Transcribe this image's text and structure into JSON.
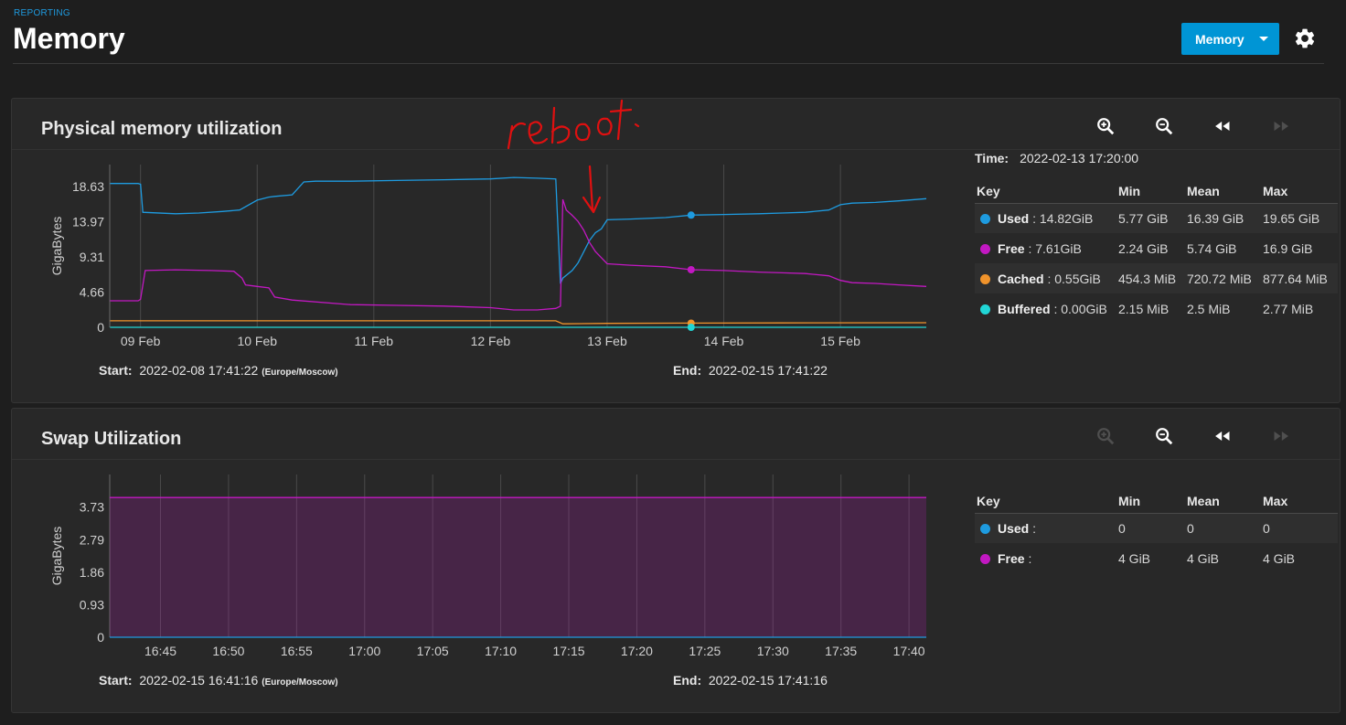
{
  "header": {
    "breadcrumb": "REPORTING",
    "title": "Memory",
    "dropdown_label": "Memory"
  },
  "icons": {
    "settings": "gear-icon",
    "zoom_in": "zoom-in-icon",
    "zoom_out": "zoom-out-icon",
    "back": "rewind-icon",
    "forward": "fast-forward-icon"
  },
  "colors": {
    "used": "#1e9be0",
    "free": "#c218c2",
    "cached": "#f0932b",
    "buffered": "#21d6d6",
    "accent": "#0095d5"
  },
  "physical": {
    "title": "Physical memory utilization",
    "time_label": "Time:",
    "time_value": "2022-02-13 17:20:00",
    "start_label": "Start:",
    "start_value": "2022-02-08 17:41:22",
    "timezone": "(Europe/Moscow)",
    "end_label": "End:",
    "end_value": "2022-02-15 17:41:22",
    "legend_headers": [
      "Key",
      "Min",
      "Mean",
      "Max"
    ],
    "legend_rows": [
      {
        "key": "Used",
        "value": " : 14.82GiB",
        "min": "5.77 GiB",
        "mean": "16.39 GiB",
        "max": "19.65 GiB"
      },
      {
        "key": "Free",
        "value": " : 7.61GiB",
        "min": "2.24 GiB",
        "mean": "5.74 GiB",
        "max": "16.9 GiB"
      },
      {
        "key": "Cached",
        "value": " : 0.55GiB",
        "min": "454.3 MiB",
        "mean": "720.72 MiB",
        "max": "877.64 MiB"
      },
      {
        "key": "Buffered",
        "value": " : 0.00GiB",
        "min": "2.15 MiB",
        "mean": "2.5 MiB",
        "max": "2.77 MiB"
      }
    ],
    "annotation": "reboot"
  },
  "swap": {
    "title": "Swap Utilization",
    "start_label": "Start:",
    "start_value": "2022-02-15 16:41:16",
    "timezone": "(Europe/Moscow)",
    "end_label": "End:",
    "end_value": "2022-02-15 17:41:16",
    "legend_headers": [
      "Key",
      "Min",
      "Mean",
      "Max"
    ],
    "legend_rows": [
      {
        "key": "Used",
        "value": " :",
        "min": "0",
        "mean": "0",
        "max": "0"
      },
      {
        "key": "Free",
        "value": " :",
        "min": "4 GiB",
        "mean": "4 GiB",
        "max": "4 GiB"
      }
    ]
  },
  "chart_data": [
    {
      "type": "line",
      "ylabel": "GigaBytes",
      "ylim": [
        0,
        21.5
      ],
      "yticks": [
        "0",
        "4.66",
        "9.31",
        "13.97",
        "18.63"
      ],
      "ytick_values": [
        0,
        4.66,
        9.31,
        13.97,
        18.63
      ],
      "xlim": [
        8.736,
        15.736
      ],
      "xticks": [
        "09 Feb",
        "10 Feb",
        "11 Feb",
        "12 Feb",
        "13 Feb",
        "14 Feb",
        "15 Feb"
      ],
      "xtick_values": [
        9,
        10,
        11,
        12,
        13,
        14,
        15
      ],
      "grid": true,
      "series": [
        {
          "name": "Used",
          "x": [
            8.74,
            8.98,
            9.0,
            9.02,
            9.3,
            9.5,
            9.7,
            9.85,
            10.0,
            10.1,
            10.15,
            10.3,
            10.4,
            10.5,
            10.8,
            11.2,
            11.6,
            12.0,
            12.2,
            12.4,
            12.56,
            12.6,
            12.62,
            12.7,
            12.75,
            12.8,
            12.85,
            12.9,
            12.95,
            13.0,
            13.2,
            13.5,
            13.72,
            14.0,
            14.3,
            14.5,
            14.7,
            14.9,
            15.0,
            15.1,
            15.3,
            15.5,
            15.736
          ],
          "y": [
            19.0,
            19.0,
            18.9,
            15.2,
            15.0,
            15.1,
            15.3,
            15.5,
            16.8,
            17.2,
            17.3,
            17.5,
            19.2,
            19.3,
            19.3,
            19.4,
            19.5,
            19.6,
            19.8,
            19.7,
            19.6,
            5.77,
            6.5,
            7.5,
            8.5,
            10.0,
            11.5,
            12.5,
            13.0,
            14.2,
            14.3,
            14.5,
            14.82,
            14.9,
            15.0,
            15.1,
            15.2,
            15.5,
            16.2,
            16.4,
            16.5,
            16.7,
            17.0
          ]
        },
        {
          "name": "Free",
          "x": [
            8.74,
            8.98,
            9.0,
            9.04,
            9.3,
            9.6,
            9.8,
            9.87,
            9.9,
            10.0,
            10.1,
            10.15,
            10.3,
            10.8,
            11.2,
            11.6,
            12.0,
            12.2,
            12.4,
            12.56,
            12.6,
            12.62,
            12.65,
            12.7,
            12.75,
            12.8,
            12.85,
            12.9,
            12.95,
            13.0,
            13.2,
            13.5,
            13.72,
            14.0,
            14.3,
            14.5,
            14.7,
            14.9,
            15.0,
            15.1,
            15.3,
            15.5,
            15.736
          ],
          "y": [
            3.5,
            3.5,
            3.7,
            7.5,
            7.6,
            7.5,
            7.4,
            6.5,
            5.6,
            5.4,
            5.2,
            4.0,
            3.6,
            3.0,
            2.9,
            2.8,
            2.6,
            2.3,
            2.3,
            2.5,
            2.8,
            16.9,
            15.5,
            14.8,
            14.0,
            12.8,
            11.2,
            10.0,
            9.2,
            8.4,
            8.2,
            8.0,
            7.61,
            7.5,
            7.3,
            7.2,
            7.1,
            6.8,
            6.2,
            5.9,
            5.8,
            5.6,
            5.4
          ]
        },
        {
          "name": "Cached",
          "x": [
            8.74,
            12.56,
            12.62,
            13.0,
            13.72,
            14.5,
            15.736
          ],
          "y": [
            0.86,
            0.86,
            0.46,
            0.52,
            0.55,
            0.58,
            0.6
          ]
        },
        {
          "name": "Buffered",
          "x": [
            8.74,
            15.736
          ],
          "y": [
            0.003,
            0.003
          ]
        }
      ],
      "markers": [
        {
          "series": "Used",
          "x": 13.72,
          "y": 14.82
        },
        {
          "series": "Free",
          "x": 13.72,
          "y": 7.61
        },
        {
          "series": "Cached",
          "x": 13.72,
          "y": 0.55
        },
        {
          "series": "Buffered",
          "x": 13.72,
          "y": 0.0
        }
      ]
    },
    {
      "type": "area",
      "ylabel": "GigaBytes",
      "ylim": [
        0,
        4.66
      ],
      "yticks": [
        "0",
        "0.93",
        "1.86",
        "2.79",
        "3.73"
      ],
      "ytick_values": [
        0,
        0.93,
        1.86,
        2.79,
        3.73
      ],
      "xlim": [
        0,
        60
      ],
      "xticks": [
        "16:45",
        "16:50",
        "16:55",
        "17:00",
        "17:05",
        "17:10",
        "17:15",
        "17:20",
        "17:25",
        "17:30",
        "17:35",
        "17:40"
      ],
      "xtick_values": [
        3.73,
        8.73,
        13.73,
        18.73,
        23.73,
        28.73,
        33.73,
        38.73,
        43.73,
        48.73,
        53.73,
        58.73
      ],
      "grid": true,
      "series": [
        {
          "name": "Free",
          "x": [
            0,
            60
          ],
          "y": [
            4.0,
            4.0
          ]
        },
        {
          "name": "Used",
          "x": [
            0,
            60
          ],
          "y": [
            0,
            0
          ]
        }
      ]
    }
  ]
}
